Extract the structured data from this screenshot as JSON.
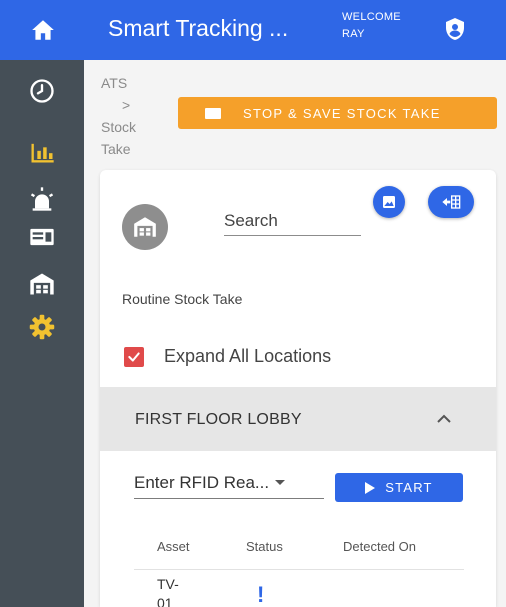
{
  "header": {
    "title": "Smart Tracking ...",
    "welcome_line1": "WELCOME",
    "welcome_line2": "RAY"
  },
  "icons": {
    "home": "home-icon",
    "account": "account-shield-icon",
    "sidebar": [
      "clock-icon",
      "bar-chart-icon",
      "alarm-light-icon",
      "id-card-icon",
      "warehouse-icon",
      "gear-icon"
    ],
    "location": "warehouse-icon",
    "fab1": "image-icon",
    "fab2": "export-table-icon",
    "status": "exclamation-icon"
  },
  "breadcrumb": {
    "root": "ATS",
    "sep": ">",
    "current_line1": "Stock",
    "current_line2": "Take"
  },
  "actions": {
    "stop_label": "STOP & SAVE STOCK TAKE",
    "start_label": "START"
  },
  "search": {
    "placeholder": "Search"
  },
  "stocktake": {
    "type": "Routine Stock Take",
    "expand_label": "Expand All Locations",
    "expand_checked": true
  },
  "location": {
    "name": "FIRST FLOOR LOBBY"
  },
  "rfid": {
    "value": "Enter RFID Rea..."
  },
  "table": {
    "columns": [
      "Asset",
      "Status",
      "Detected On"
    ],
    "rows": [
      {
        "asset": "TV-01",
        "status": "!",
        "detected": ""
      }
    ]
  },
  "colors": {
    "primary": "#2f67e6",
    "sidebar": "#454f57",
    "warning": "#f5a02a",
    "checkbox": "#e04a4a",
    "panel": "#e6e6e6",
    "accent_gear": "#f2c230"
  }
}
